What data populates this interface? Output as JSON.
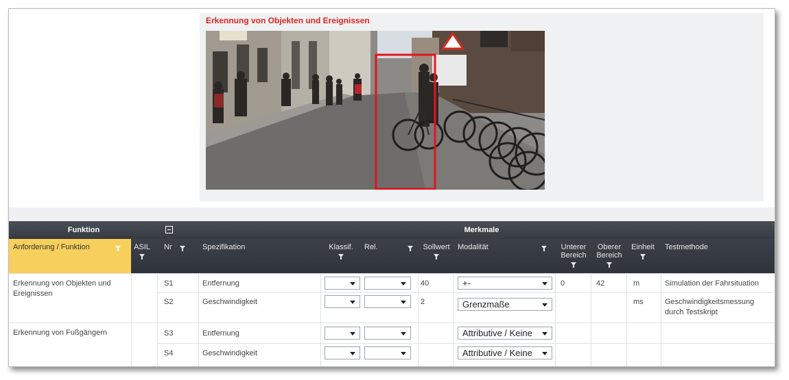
{
  "image_panel": {
    "title": "Erkennung von Objekten und Ereignissen"
  },
  "table": {
    "group_headers": {
      "funktion": "Funktion",
      "merkmale": "Merkmale"
    },
    "columns": {
      "anforderung": "Anforderung / Funktion",
      "asil": "ASIL",
      "nr": "Nr",
      "spezifikation": "Spezifikation",
      "klassif": "Klassif.",
      "rel": "Rel.",
      "sollwert": "Sollwert",
      "modalitaet": "Modalität",
      "unterer_1": "Unterer",
      "unterer_2": "Bereich",
      "oberer_1": "Oberer",
      "oberer_2": "Bereich",
      "einheit": "Einheit",
      "testmethode": "Testmethode"
    },
    "groups": [
      {
        "funktion_line1": "Erkennung von Objekten und",
        "funktion_line2": "Ereignissen"
      },
      {
        "funktion_line1": "Erkennung von Fußgängern",
        "funktion_line2": ""
      }
    ],
    "rows": [
      {
        "nr": "S1",
        "spezifikation": "Entfernung",
        "sollwert": "40",
        "modalitaet": "+-",
        "unterer": "0",
        "oberer": "42",
        "einheit": "m",
        "testmethode_1": "Simulation der Fahrsituation",
        "testmethode_2": ""
      },
      {
        "nr": "S2",
        "spezifikation": "Geschwindigkeit",
        "sollwert": "2",
        "modalitaet": "Grenzmaße",
        "unterer": "",
        "oberer": "",
        "einheit": "ms",
        "testmethode_1": "Geschwindigkeitsmessung",
        "testmethode_2": "durch Testskript"
      },
      {
        "nr": "S3",
        "spezifikation": "Entfernung",
        "sollwert": "",
        "modalitaet": "Attributive / Keine",
        "unterer": "",
        "oberer": "",
        "einheit": "",
        "testmethode_1": "",
        "testmethode_2": ""
      },
      {
        "nr": "S4",
        "spezifikation": "Geschwindigkeit",
        "sollwert": "",
        "modalitaet": "Attributive / Keine",
        "unterer": "",
        "oberer": "",
        "einheit": "",
        "testmethode_1": "",
        "testmethode_2": ""
      }
    ]
  },
  "colors": {
    "title_red": "#e0231c",
    "header_dark": "#363a41",
    "highlight_yellow": "#f7cf5c",
    "detection_box": "#e3141c"
  }
}
